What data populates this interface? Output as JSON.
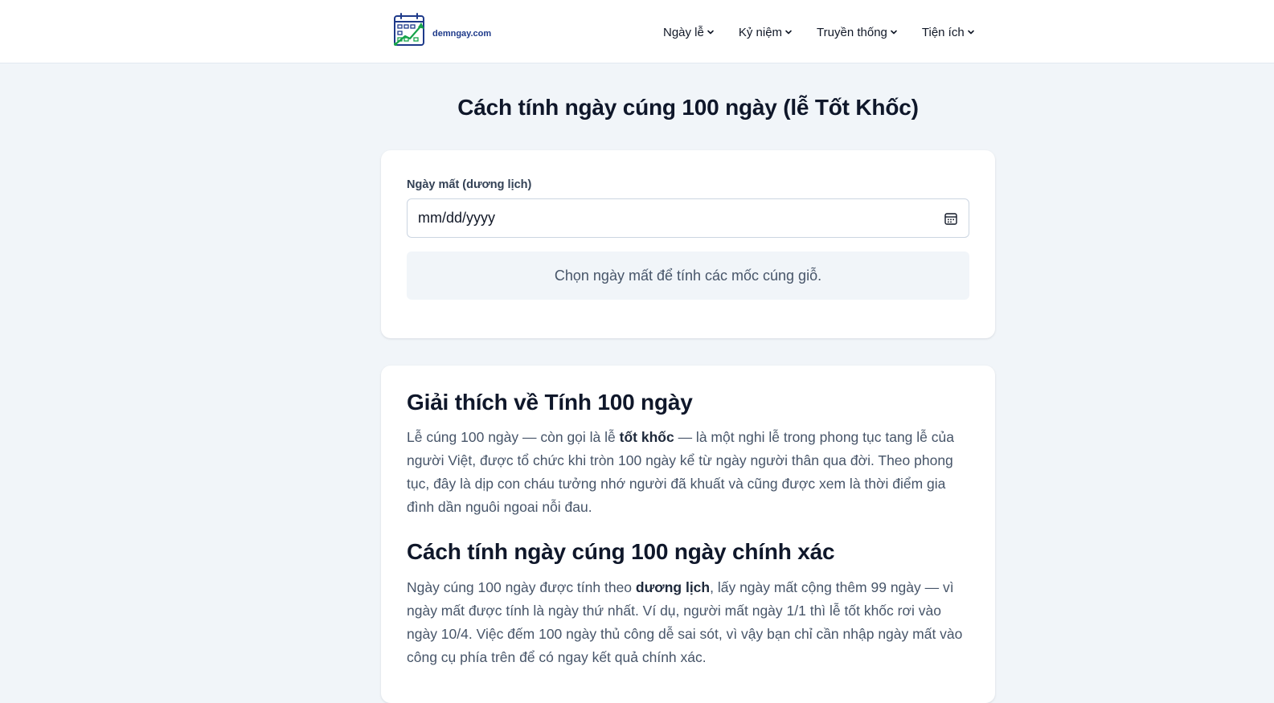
{
  "site": {
    "logo_text": "demngay.com"
  },
  "nav": {
    "items": [
      {
        "label": "Ngày lễ"
      },
      {
        "label": "Kỷ niệm"
      },
      {
        "label": "Truyền thống"
      },
      {
        "label": "Tiện ích"
      }
    ]
  },
  "page": {
    "title": "Cách tính ngày cúng 100 ngày (lễ Tốt Khốc)"
  },
  "tool": {
    "field_label": "Ngày mất (dương lịch)",
    "date_placeholder": "mm/dd/yyyy",
    "result_text": "Chọn ngày mất để tính các mốc cúng giỗ."
  },
  "article": {
    "section1": {
      "heading": "Giải thích về Tính 100 ngày",
      "p_before": "Lễ cúng 100 ngày — còn gọi là lễ ",
      "p_bold": "tốt khốc",
      "p_after": " — là một nghi lễ trong phong tục tang lễ của người Việt, được tổ chức khi tròn 100 ngày kể từ ngày người thân qua đời. Theo phong tục, đây là dịp con cháu tưởng nhớ người đã khuất và cũng được xem là thời điểm gia đình dần nguôi ngoai nỗi đau."
    },
    "section2": {
      "heading": "Cách tính ngày cúng 100 ngày chính xác",
      "p_before": "Ngày cúng 100 ngày được tính theo ",
      "p_bold": "dương lịch",
      "p_after": ", lấy ngày mất cộng thêm 99 ngày — vì ngày mất được tính là ngày thứ nhất. Ví dụ, người mất ngày 1/1 thì lễ tốt khốc rơi vào ngày 10/4. Việc đếm 100 ngày thủ công dễ sai sót, vì vậy bạn chỉ cần nhập ngày mất vào công cụ phía trên để có ngay kết quả chính xác."
    }
  },
  "colors": {
    "page_bg": "#f1f5f9",
    "logo_blue": "#1e3a8a",
    "logo_green": "#16a34a"
  }
}
